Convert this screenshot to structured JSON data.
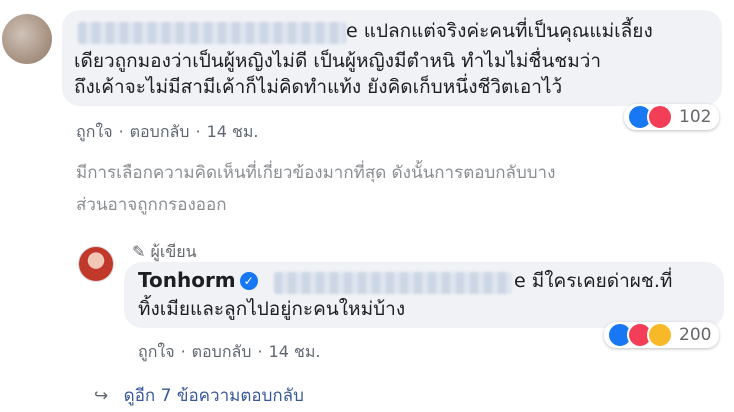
{
  "comment1": {
    "line1_suffix": "e แปลกแต่จริงค่ะคนที่เป็นคุณแม่เลี้ยง",
    "line2": "เดียวถูกมองว่าเป็นผู้หญิงไม่ดี เป็นผู้หญิงมีตำหนิ ทำไมไม่ชื่นชมว่า",
    "line3": "ถึงเค้าจะไม่มีสามีเค้าก็ไม่คิดทำแท้ง ยังคิดเก็บหนึ่งชีวิตเอาไว้",
    "reaction_count": "102",
    "like_label": "ถูกใจ",
    "reply_label": "ตอบกลับ",
    "time": "14 ชม.",
    "separator": "·"
  },
  "notice": {
    "line1": "มีการเลือกความคิดเห็นที่เกี่ยวข้องมากที่สุด ดังนั้นการตอบกลับบาง",
    "line2": "ส่วนอาจถูกกรองออก"
  },
  "comment2": {
    "author_label": "ผู้เขียน",
    "name": "Tonhorm",
    "verified_glyph": "✓",
    "line1_suffix": "e มีใครเคยด่าผช.ที่",
    "line2": "ทิ้งเมียและลูกไปอยู่กะคนใหม่บ้าง",
    "reaction_count": "200",
    "like_label": "ถูกใจ",
    "reply_label": "ตอบกลับ",
    "time": "14 ชม.",
    "separator": "·"
  },
  "more_replies": {
    "label": "ดูอีก 7 ข้อความตอบกลับ",
    "icon": "reply-arrow-icon"
  },
  "colors": {
    "bubble": "#f0f2f5",
    "like": "#1877f2",
    "love": "#f33e58",
    "haha": "#f7b928",
    "link": "#385898"
  }
}
